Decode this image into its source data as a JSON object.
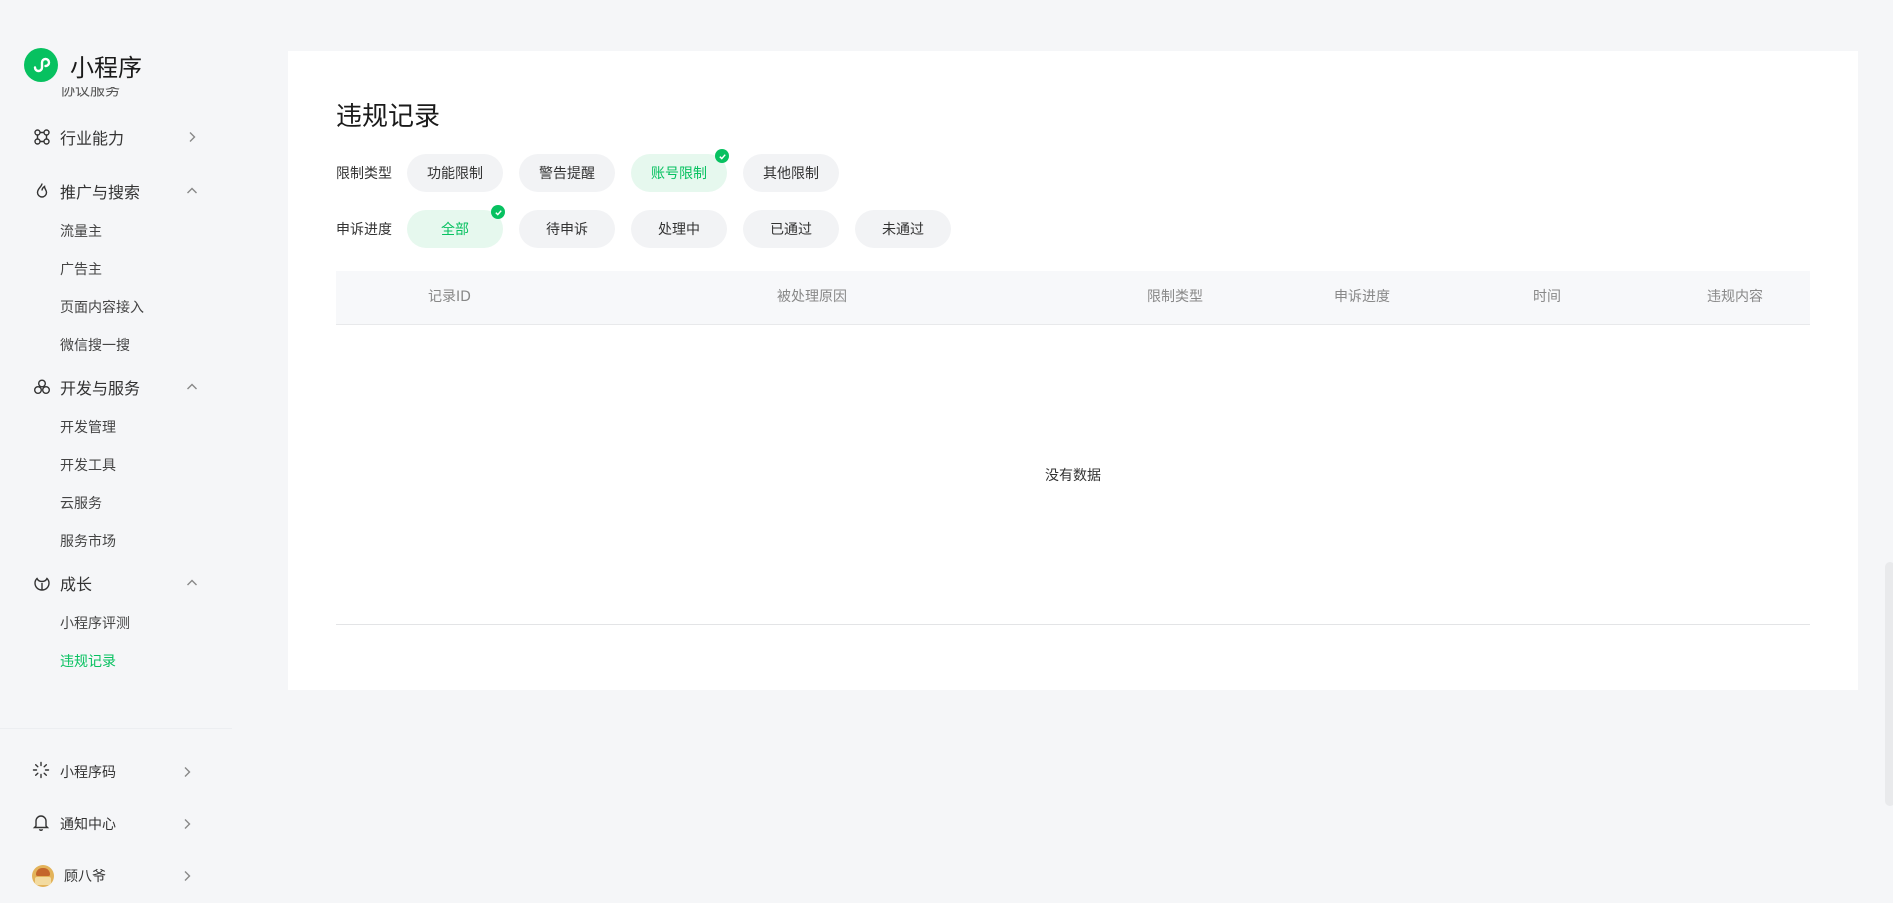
{
  "app": {
    "name": "小程序",
    "brand_color": "#07c160"
  },
  "sidebar": {
    "cut_item": "协议服务",
    "groups": [
      {
        "label": "行业能力",
        "icon": "industry-icon",
        "expanded": false
      },
      {
        "label": "推广与搜索",
        "icon": "flame-icon",
        "expanded": true,
        "items": [
          "流量主",
          "广告主",
          "页面内容接入",
          "微信搜一搜"
        ]
      },
      {
        "label": "开发与服务",
        "icon": "circles-icon",
        "expanded": true,
        "items": [
          "开发管理",
          "开发工具",
          "云服务",
          "服务市场"
        ]
      },
      {
        "label": "成长",
        "icon": "growth-icon",
        "expanded": true,
        "items": [
          "小程序评测",
          "违规记录"
        ],
        "active_item": "违规记录"
      }
    ],
    "bottom": [
      {
        "label": "小程序码",
        "icon": "sun-icon"
      },
      {
        "label": "通知中心",
        "icon": "bell-icon"
      },
      {
        "label": "顾八爷",
        "icon": "avatar"
      }
    ]
  },
  "main": {
    "title": "违规记录",
    "filters": {
      "type": {
        "label": "限制类型",
        "options": [
          "功能限制",
          "警告提醒",
          "账号限制",
          "其他限制"
        ],
        "selected": "账号限制"
      },
      "appeal": {
        "label": "申诉进度",
        "options": [
          "全部",
          "待申诉",
          "处理中",
          "已通过",
          "未通过"
        ],
        "selected": "全部"
      }
    },
    "table": {
      "columns": [
        "记录ID",
        "被处理原因",
        "限制类型",
        "申诉进度",
        "时间",
        "违规内容"
      ],
      "rows": [],
      "empty_text": "没有数据"
    }
  }
}
